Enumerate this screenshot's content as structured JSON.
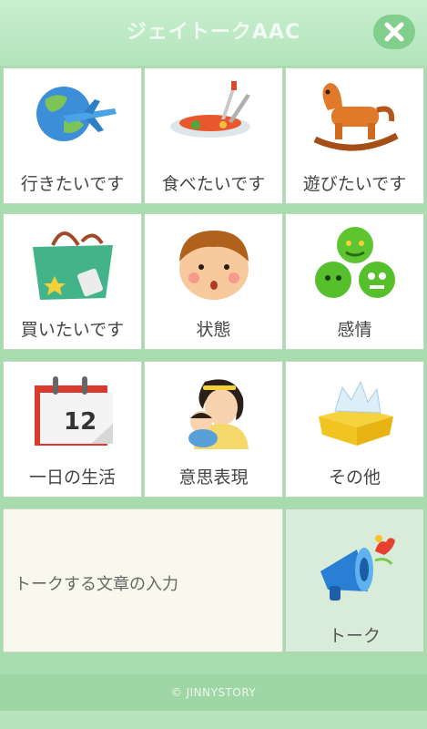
{
  "header": {
    "title": "ジェイトークAAC",
    "close_icon": "close-icon"
  },
  "tiles": [
    {
      "label": "行きたいです",
      "icon": "travel-globe-plane-icon"
    },
    {
      "label": "食べたいです",
      "icon": "food-plate-icon"
    },
    {
      "label": "遊びたいです",
      "icon": "rocking-horse-icon"
    },
    {
      "label": "買いたいです",
      "icon": "shopping-bag-icon"
    },
    {
      "label": "状態",
      "icon": "boy-face-icon"
    },
    {
      "label": "感情",
      "icon": "emotion-smileys-icon"
    },
    {
      "label": "一日の生活",
      "icon": "calendar-icon"
    },
    {
      "label": "意思表現",
      "icon": "mother-child-icon"
    },
    {
      "label": "その他",
      "icon": "gift-box-icon"
    }
  ],
  "composer": {
    "input_text": "トークする文章の入力",
    "talk_label": "トーク",
    "talk_icon": "megaphone-icon"
  },
  "footer": {
    "copyright": "© JINNYSTORY"
  },
  "colors": {
    "header_bg": "#b3e4bb",
    "accent": "#82cf8d",
    "background": "#a8dcaf"
  }
}
